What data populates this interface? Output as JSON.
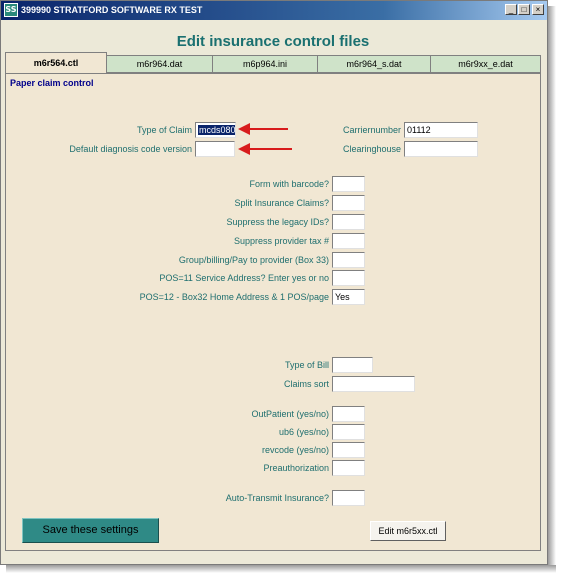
{
  "window": {
    "title": "399990 STRATFORD SOFTWARE RX TEST",
    "minimize": "_",
    "maximize": "□",
    "close": "×",
    "icon_text": "SS"
  },
  "header": {
    "title": "Edit insurance control files"
  },
  "tabs": [
    {
      "label": "m6r564.ctl",
      "active": true
    },
    {
      "label": "m6r964.dat",
      "active": false
    },
    {
      "label": "m6p964.ini",
      "active": false
    },
    {
      "label": "m6r964_s.dat",
      "active": false
    },
    {
      "label": "m6r9xx_e.dat",
      "active": false
    }
  ],
  "section": {
    "title": "Paper claim control"
  },
  "fields": {
    "type_of_claim": {
      "label": "Type of Claim",
      "value": "mcds080"
    },
    "default_diag": {
      "label": "Default diagnosis code version",
      "value": ""
    },
    "carriernumber": {
      "label": "Carriernumber",
      "value": "01112"
    },
    "clearinghouse": {
      "label": "Clearinghouse",
      "value": ""
    },
    "form_barcode": {
      "label": "Form with barcode?",
      "value": ""
    },
    "split_claims": {
      "label": "Split Insurance Claims?",
      "value": ""
    },
    "suppress_legacy": {
      "label": "Suppress the legacy IDs?",
      "value": ""
    },
    "suppress_tax": {
      "label": "Suppress provider tax #",
      "value": ""
    },
    "group_billing": {
      "label": "Group/billing/Pay to provider (Box 33)",
      "value": ""
    },
    "pos11": {
      "label": "POS=11 Service Address? Enter yes or no",
      "value": ""
    },
    "pos12": {
      "label": "POS=12 - Box32 Home Address & 1 POS/page",
      "value": "Yes"
    },
    "type_of_bill": {
      "label": "Type of Bill",
      "value": ""
    },
    "claims_sort": {
      "label": "Claims sort",
      "value": ""
    },
    "outpatient": {
      "label": "OutPatient (yes/no)",
      "value": ""
    },
    "ub6": {
      "label": "ub6 (yes/no)",
      "value": ""
    },
    "revcode": {
      "label": "revcode  (yes/no)",
      "value": ""
    },
    "preauth": {
      "label": "Preauthorization",
      "value": ""
    },
    "auto_transmit": {
      "label": "Auto-Transmit Insurance?",
      "value": ""
    }
  },
  "buttons": {
    "save": "Save these settings",
    "edit": "Edit m6r5xx.ctl"
  },
  "colors": {
    "accent": "#2f8a86",
    "label": "#1f6f6f",
    "arrow": "#d81c1c",
    "section": "#00008b"
  }
}
